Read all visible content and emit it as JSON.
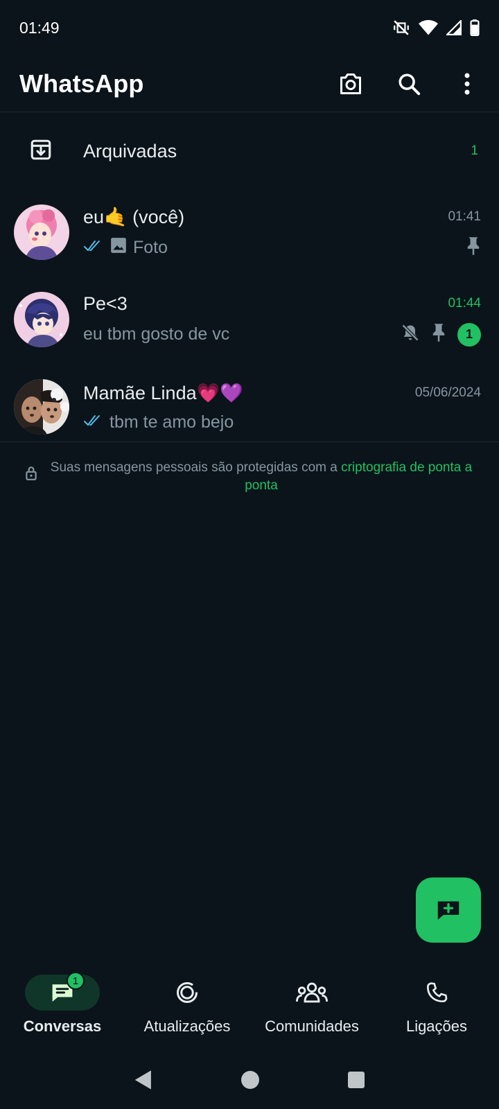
{
  "status_bar": {
    "time": "01:49"
  },
  "header": {
    "title": "WhatsApp"
  },
  "archived": {
    "label": "Arquivadas",
    "count": "1"
  },
  "chats": [
    {
      "name": "eu🤙 (você)",
      "time": "01:41",
      "preview": "Foto",
      "preview_type": "photo",
      "read_ticks": true,
      "pinned": true,
      "muted": false,
      "unread": ""
    },
    {
      "name": "Pe<3",
      "time": "01:44",
      "preview": "eu tbm gosto de vc",
      "preview_type": "text",
      "read_ticks": false,
      "pinned": true,
      "muted": true,
      "unread": "1"
    },
    {
      "name": "Mamãe Linda💗💜",
      "time": "05/06/2024",
      "preview": "tbm te amo bejo",
      "preview_type": "text",
      "read_ticks": true,
      "pinned": false,
      "muted": false,
      "unread": ""
    }
  ],
  "encryption": {
    "text": "Suas mensagens pessoais são protegidas com a ",
    "link": "criptografia de ponta a ponta"
  },
  "bottom_nav": [
    {
      "label": "Conversas",
      "badge": "1",
      "active": true
    },
    {
      "label": "Atualizações",
      "active": false
    },
    {
      "label": "Comunidades",
      "active": false
    },
    {
      "label": "Ligações",
      "active": false
    }
  ],
  "colors": {
    "background": "#0b141a",
    "accent": "#21c063",
    "secondary_text": "#8696a0",
    "read_ticks": "#53bdeb"
  }
}
